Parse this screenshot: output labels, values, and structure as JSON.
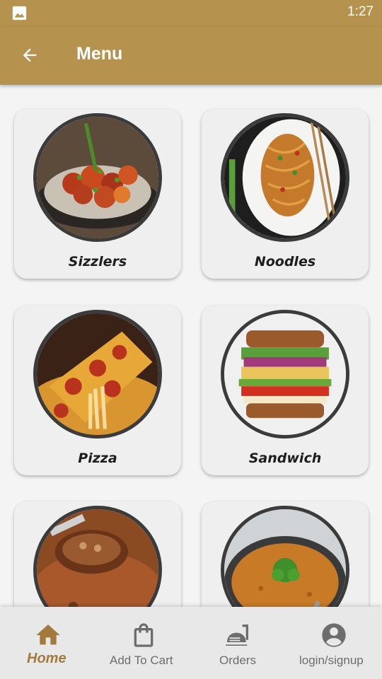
{
  "status_bar": {
    "time": "1:27",
    "notification_icon": "image-icon"
  },
  "app_bar": {
    "title": "Menu",
    "back_icon": "arrow-left-icon"
  },
  "menu_items": [
    {
      "label": "Sizzlers"
    },
    {
      "label": "Noodles"
    },
    {
      "label": "Pizza"
    },
    {
      "label": "Sandwich"
    },
    {
      "label": ""
    },
    {
      "label": ""
    }
  ],
  "bottom_nav": [
    {
      "label": "Home",
      "icon": "home-icon",
      "active": true
    },
    {
      "label": "Add To Cart",
      "icon": "shopping-bag-icon",
      "active": false
    },
    {
      "label": "Orders",
      "icon": "food-cloche-icon",
      "active": false
    },
    {
      "label": "login/signup",
      "icon": "account-circle-icon",
      "active": false
    }
  ],
  "colors": {
    "primary": "#b5934f",
    "active_nav": "#a27a3e",
    "inactive_nav": "#6d6d6d",
    "card_bg": "#efefef"
  }
}
